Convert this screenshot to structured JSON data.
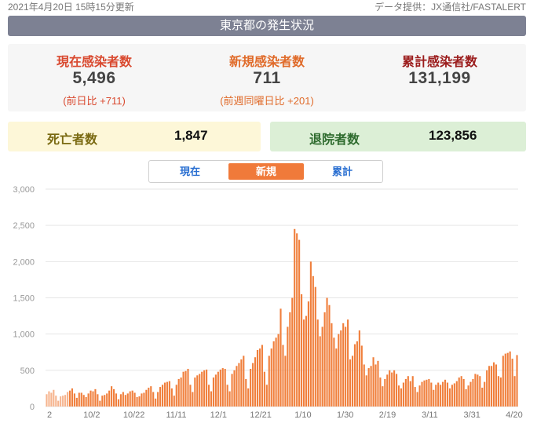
{
  "header": {
    "updated": "2021年4月20日 15時15分更新",
    "source": "データ提供：JX通信社/FASTALERT"
  },
  "title": "東京都の発生状況",
  "stats": {
    "current": {
      "label": "現在感染者数",
      "value": "5,496",
      "sub": "(前日比 +711)",
      "label_color": "#d9492f"
    },
    "new": {
      "label": "新規感染者数",
      "value": "711",
      "sub": "(前週同曜日比 +201)",
      "label_color": "#e06b2a"
    },
    "total": {
      "label": "累計感染者数",
      "value": "131,199",
      "sub": "",
      "label_color": "#9b1c1c"
    }
  },
  "deaths": {
    "label": "死亡者数",
    "value": "1,847",
    "label_color": "#7a6a12"
  },
  "discharged": {
    "label": "退院者数",
    "value": "123,856",
    "label_color": "#2e6b2e"
  },
  "tabs": [
    {
      "label": "現在",
      "active": false
    },
    {
      "label": "新規",
      "active": true
    },
    {
      "label": "累計",
      "active": false
    }
  ],
  "chart_data": {
    "type": "bar",
    "title": "",
    "xlabel": "",
    "ylabel": "",
    "ylim": [
      0,
      3000
    ],
    "yticks": [
      "0",
      "500",
      "1,000",
      "1,500",
      "2,000",
      "2,500",
      "3,000"
    ],
    "xtick_labels": [
      "2",
      "10/2",
      "10/22",
      "11/11",
      "12/1",
      "12/21",
      "1/10",
      "1/30",
      "2/19",
      "3/11",
      "3/31",
      "4/20"
    ],
    "grid": true,
    "bar_color": "#f07f3c",
    "early_bar_color": "#f6b48e",
    "series": [
      {
        "values": [
          170,
          210,
          190,
          230,
          150,
          80,
          140,
          150,
          160,
          200,
          220,
          250,
          180,
          120,
          190,
          190,
          160,
          130,
          180,
          220,
          210,
          240,
          170,
          80,
          150,
          160,
          180,
          220,
          280,
          240,
          180,
          100,
          170,
          200,
          160,
          180,
          210,
          220,
          190,
          130,
          140,
          180,
          190,
          230,
          260,
          280,
          200,
          110,
          200,
          270,
          300,
          330,
          340,
          350,
          250,
          150,
          300,
          380,
          400,
          480,
          490,
          520,
          300,
          200,
          400,
          430,
          450,
          480,
          500,
          510,
          300,
          210,
          400,
          440,
          480,
          510,
          530,
          520,
          300,
          210,
          450,
          500,
          560,
          600,
          650,
          700,
          380,
          250,
          520,
          600,
          680,
          780,
          800,
          850,
          480,
          300,
          700,
          800,
          900,
          950,
          1000,
          1350,
          850,
          700,
          1100,
          1300,
          1500,
          2450,
          2390,
          2300,
          1550,
          1200,
          1250,
          1450,
          2000,
          1800,
          1650,
          1200,
          970,
          1100,
          1300,
          1500,
          1400,
          1150,
          950,
          800,
          1000,
          1050,
          1150,
          1100,
          1200,
          650,
          700,
          860,
          900,
          1050,
          840,
          580,
          430,
          530,
          560,
          680,
          580,
          630,
          400,
          280,
          380,
          440,
          500,
          470,
          500,
          450,
          290,
          250,
          330,
          380,
          420,
          350,
          420,
          270,
          200,
          290,
          340,
          360,
          370,
          380,
          330,
          230,
          300,
          330,
          300,
          340,
          370,
          330,
          250,
          300,
          320,
          350,
          400,
          420,
          380,
          240,
          290,
          340,
          380,
          450,
          440,
          420,
          260,
          340,
          500,
          560,
          560,
          610,
          580,
          420,
          400,
          700,
          730,
          740,
          760,
          660,
          420,
          710
        ]
      }
    ]
  }
}
